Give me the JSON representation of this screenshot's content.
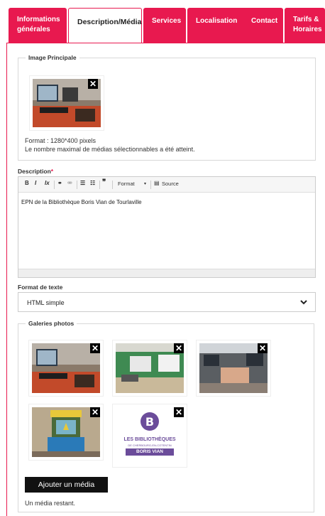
{
  "tabs": [
    {
      "label": "Informations générales",
      "line1": "Informations",
      "line2": "générales"
    },
    {
      "label": "Description/Média"
    },
    {
      "label": "Services"
    },
    {
      "label": "Localisation"
    },
    {
      "label": "Contact"
    },
    {
      "label": "Tarifs & Horaires",
      "line1": "Tarifs &",
      "line2": "Horaires"
    }
  ],
  "main_image": {
    "legend": "Image Principale",
    "format": "Format : 1280*400 pixels",
    "limit_note": "Le nombre maximal de médias sélectionnables a été atteint."
  },
  "description": {
    "label": "Description",
    "required_mark": "*",
    "toolbar": {
      "bold": "B",
      "italic": "I",
      "clear": "Ix",
      "format": "Format",
      "source": "Source"
    },
    "content": "EPN de la Bibliothèque Boris Vian de Tourlaville"
  },
  "text_format": {
    "label": "Format de texte",
    "selected": "HTML simple"
  },
  "gallery": {
    "legend": "Galeries photos",
    "logo_lines": [
      "LES BIBLIOTHÈQUES",
      "DE CHERBOURG-EN-COTENTIN",
      "BORIS VIAN"
    ],
    "add_button": "Ajouter un média",
    "remaining": "Un média restant."
  },
  "colors": {
    "accent": "#e8194f",
    "logo_purple": "#6b4c9a"
  }
}
